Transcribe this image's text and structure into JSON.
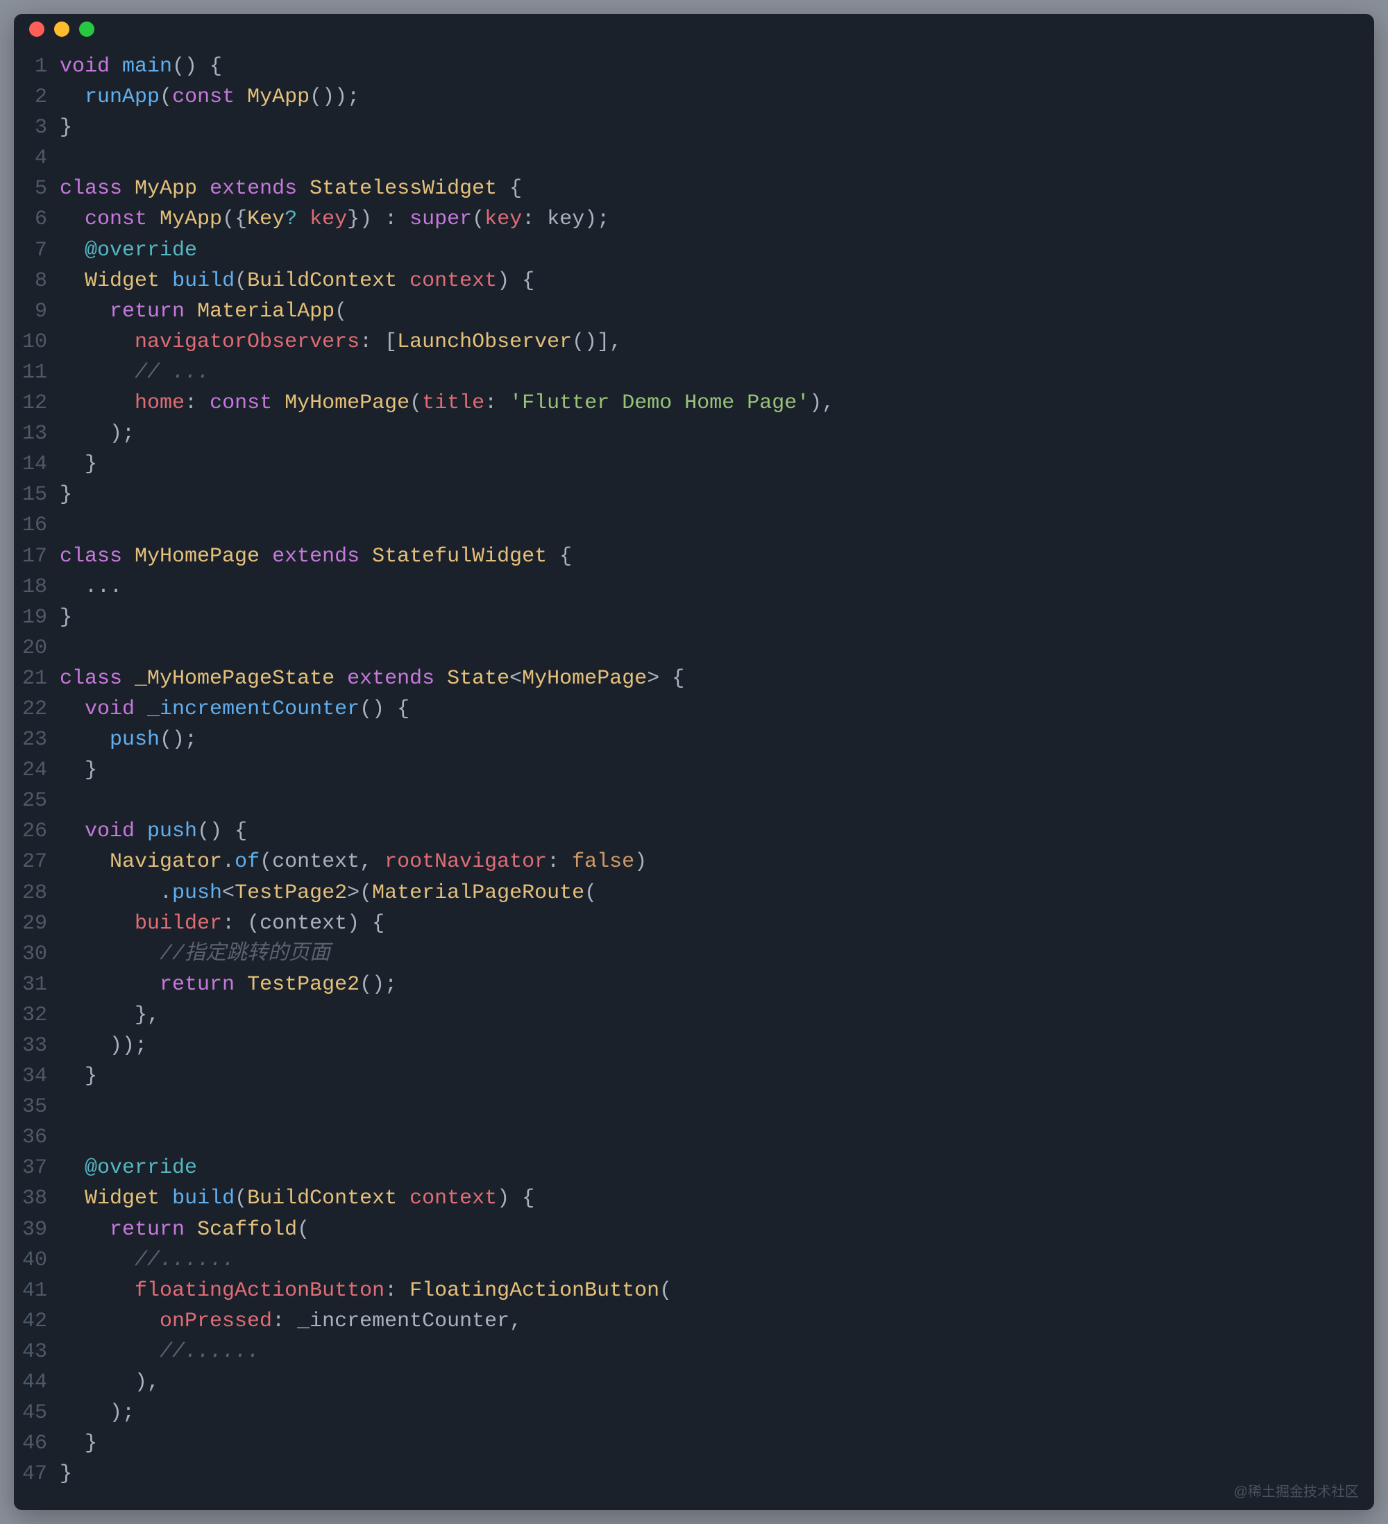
{
  "watermark": "@稀土掘金技术社区",
  "code_lines": [
    [
      [
        "keyword",
        "void"
      ],
      [
        "punct",
        " "
      ],
      [
        "func",
        "main"
      ],
      [
        "punct",
        "() {"
      ]
    ],
    [
      [
        "punct",
        "  "
      ],
      [
        "func",
        "runApp"
      ],
      [
        "punct",
        "("
      ],
      [
        "keyword",
        "const"
      ],
      [
        "punct",
        " "
      ],
      [
        "type",
        "MyApp"
      ],
      [
        "punct",
        "());"
      ]
    ],
    [
      [
        "punct",
        "}"
      ]
    ],
    [],
    [
      [
        "keyword",
        "class"
      ],
      [
        "punct",
        " "
      ],
      [
        "type",
        "MyApp"
      ],
      [
        "punct",
        " "
      ],
      [
        "keyword",
        "extends"
      ],
      [
        "punct",
        " "
      ],
      [
        "type",
        "StatelessWidget"
      ],
      [
        "punct",
        " {"
      ]
    ],
    [
      [
        "punct",
        "  "
      ],
      [
        "keyword",
        "const"
      ],
      [
        "punct",
        " "
      ],
      [
        "type",
        "MyApp"
      ],
      [
        "punct",
        "({"
      ],
      [
        "type",
        "Key"
      ],
      [
        "op",
        "?"
      ],
      [
        "punct",
        " "
      ],
      [
        "param",
        "key"
      ],
      [
        "punct",
        "}) : "
      ],
      [
        "keyword",
        "super"
      ],
      [
        "punct",
        "("
      ],
      [
        "param",
        "key"
      ],
      [
        "punct",
        ": key);"
      ]
    ],
    [
      [
        "punct",
        "  "
      ],
      [
        "override",
        "@override"
      ]
    ],
    [
      [
        "punct",
        "  "
      ],
      [
        "type",
        "Widget"
      ],
      [
        "punct",
        " "
      ],
      [
        "func",
        "build"
      ],
      [
        "punct",
        "("
      ],
      [
        "type",
        "BuildContext"
      ],
      [
        "punct",
        " "
      ],
      [
        "param",
        "context"
      ],
      [
        "punct",
        ") {"
      ]
    ],
    [
      [
        "punct",
        "    "
      ],
      [
        "keyword",
        "return"
      ],
      [
        "punct",
        " "
      ],
      [
        "type",
        "MaterialApp"
      ],
      [
        "punct",
        "("
      ]
    ],
    [
      [
        "punct",
        "      "
      ],
      [
        "param",
        "navigatorObservers"
      ],
      [
        "punct",
        ": ["
      ],
      [
        "type",
        "LaunchObserver"
      ],
      [
        "punct",
        "()],"
      ]
    ],
    [
      [
        "punct",
        "      "
      ],
      [
        "comment",
        "// ..."
      ]
    ],
    [
      [
        "punct",
        "      "
      ],
      [
        "param",
        "home"
      ],
      [
        "punct",
        ": "
      ],
      [
        "keyword",
        "const"
      ],
      [
        "punct",
        " "
      ],
      [
        "type",
        "MyHomePage"
      ],
      [
        "punct",
        "("
      ],
      [
        "param",
        "title"
      ],
      [
        "punct",
        ": "
      ],
      [
        "str",
        "'Flutter Demo Home Page'"
      ],
      [
        "punct",
        "),"
      ]
    ],
    [
      [
        "punct",
        "    );"
      ]
    ],
    [
      [
        "punct",
        "  }"
      ]
    ],
    [
      [
        "punct",
        "}"
      ]
    ],
    [],
    [
      [
        "keyword",
        "class"
      ],
      [
        "punct",
        " "
      ],
      [
        "type",
        "MyHomePage"
      ],
      [
        "punct",
        " "
      ],
      [
        "keyword",
        "extends"
      ],
      [
        "punct",
        " "
      ],
      [
        "type",
        "StatefulWidget"
      ],
      [
        "punct",
        " {"
      ]
    ],
    [
      [
        "punct",
        "  ..."
      ]
    ],
    [
      [
        "punct",
        "}"
      ]
    ],
    [],
    [
      [
        "keyword",
        "class"
      ],
      [
        "punct",
        " "
      ],
      [
        "type",
        "_MyHomePageState"
      ],
      [
        "punct",
        " "
      ],
      [
        "keyword",
        "extends"
      ],
      [
        "punct",
        " "
      ],
      [
        "type",
        "State"
      ],
      [
        "punct",
        "<"
      ],
      [
        "type",
        "MyHomePage"
      ],
      [
        "punct",
        "> {"
      ]
    ],
    [
      [
        "punct",
        "  "
      ],
      [
        "keyword",
        "void"
      ],
      [
        "punct",
        " "
      ],
      [
        "func",
        "_incrementCounter"
      ],
      [
        "punct",
        "() {"
      ]
    ],
    [
      [
        "punct",
        "    "
      ],
      [
        "func",
        "push"
      ],
      [
        "punct",
        "();"
      ]
    ],
    [
      [
        "punct",
        "  }"
      ]
    ],
    [],
    [
      [
        "punct",
        "  "
      ],
      [
        "keyword",
        "void"
      ],
      [
        "punct",
        " "
      ],
      [
        "func",
        "push"
      ],
      [
        "punct",
        "() {"
      ]
    ],
    [
      [
        "punct",
        "    "
      ],
      [
        "type",
        "Navigator"
      ],
      [
        "punct",
        "."
      ],
      [
        "func",
        "of"
      ],
      [
        "punct",
        "(context, "
      ],
      [
        "param",
        "rootNavigator"
      ],
      [
        "punct",
        ": "
      ],
      [
        "bool",
        "false"
      ],
      [
        "punct",
        ")"
      ]
    ],
    [
      [
        "punct",
        "        ."
      ],
      [
        "func",
        "push"
      ],
      [
        "punct",
        "<"
      ],
      [
        "type",
        "TestPage2"
      ],
      [
        "punct",
        ">("
      ],
      [
        "type",
        "MaterialPageRoute"
      ],
      [
        "punct",
        "("
      ]
    ],
    [
      [
        "punct",
        "      "
      ],
      [
        "param",
        "builder"
      ],
      [
        "punct",
        ": (context) {"
      ]
    ],
    [
      [
        "punct",
        "        "
      ],
      [
        "comment",
        "//指定跳转的页面"
      ]
    ],
    [
      [
        "punct",
        "        "
      ],
      [
        "keyword",
        "return"
      ],
      [
        "punct",
        " "
      ],
      [
        "type",
        "TestPage2"
      ],
      [
        "punct",
        "();"
      ]
    ],
    [
      [
        "punct",
        "      },"
      ]
    ],
    [
      [
        "punct",
        "    ));"
      ]
    ],
    [
      [
        "punct",
        "  }"
      ]
    ],
    [],
    [],
    [
      [
        "punct",
        "  "
      ],
      [
        "override",
        "@override"
      ]
    ],
    [
      [
        "punct",
        "  "
      ],
      [
        "type",
        "Widget"
      ],
      [
        "punct",
        " "
      ],
      [
        "func",
        "build"
      ],
      [
        "punct",
        "("
      ],
      [
        "type",
        "BuildContext"
      ],
      [
        "punct",
        " "
      ],
      [
        "param",
        "context"
      ],
      [
        "punct",
        ") {"
      ]
    ],
    [
      [
        "punct",
        "    "
      ],
      [
        "keyword",
        "return"
      ],
      [
        "punct",
        " "
      ],
      [
        "type",
        "Scaffold"
      ],
      [
        "punct",
        "("
      ]
    ],
    [
      [
        "punct",
        "      "
      ],
      [
        "comment",
        "//......"
      ]
    ],
    [
      [
        "punct",
        "      "
      ],
      [
        "param",
        "floatingActionButton"
      ],
      [
        "punct",
        ": "
      ],
      [
        "type",
        "FloatingActionButton"
      ],
      [
        "punct",
        "("
      ]
    ],
    [
      [
        "punct",
        "        "
      ],
      [
        "param",
        "onPressed"
      ],
      [
        "punct",
        ": _incrementCounter,"
      ]
    ],
    [
      [
        "punct",
        "        "
      ],
      [
        "comment",
        "//......"
      ]
    ],
    [
      [
        "punct",
        "      ),"
      ]
    ],
    [
      [
        "punct",
        "    );"
      ]
    ],
    [
      [
        "punct",
        "  }"
      ]
    ],
    [
      [
        "punct",
        "}"
      ]
    ]
  ]
}
